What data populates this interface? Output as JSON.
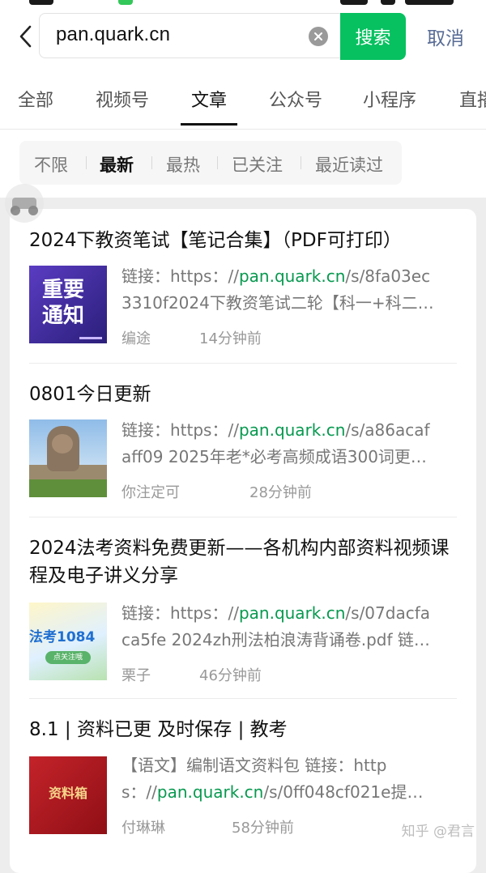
{
  "search": {
    "query": "pan.quark.cn",
    "search_label": "搜索",
    "cancel_label": "取消"
  },
  "tabs": [
    {
      "label": "全部",
      "active": false
    },
    {
      "label": "视频号",
      "active": false
    },
    {
      "label": "文章",
      "active": true
    },
    {
      "label": "公众号",
      "active": false
    },
    {
      "label": "小程序",
      "active": false
    },
    {
      "label": "直播",
      "active": false
    }
  ],
  "filters": [
    {
      "label": "不限",
      "active": false
    },
    {
      "label": "最新",
      "active": true
    },
    {
      "label": "最热",
      "active": false
    },
    {
      "label": "已关注",
      "active": false
    },
    {
      "label": "最近读过",
      "active": false
    }
  ],
  "results": [
    {
      "title": "2024下教资笔试【笔记合集】（PDF可打印）",
      "thumb_text": "重要\n通知",
      "snippet_prefix": "链接：https：//",
      "snippet_link": "pan.quark.cn",
      "snippet_suffix": "/s/8fa03ec",
      "snippet_line2": "3310f2024下教资笔试二轮【科一+科二…",
      "author": "编途",
      "time": "14分钟前"
    },
    {
      "title": "0801今日更新",
      "snippet_prefix": "链接：https：//",
      "snippet_link": "pan.quark.cn",
      "snippet_suffix": "/s/a86acaf",
      "snippet_line2": "aff09 2025年老*必考高频成语300词更…",
      "author": "你注定可",
      "time": "28分钟前"
    },
    {
      "title": "2024法考资料免费更新——各机构内部资料视频课程及电子讲义分享",
      "thumb_text": "法考1084",
      "thumb_sub": "点关注哦",
      "snippet_prefix": "链接：https：//",
      "snippet_link": "pan.quark.cn",
      "snippet_suffix": "/s/07dacfa",
      "snippet_line2": "ca5fe 2024zh刑法柏浪涛背诵卷.pdf 链…",
      "author": "栗子",
      "time": "46分钟前"
    },
    {
      "title": "8.1 | 资料已更 及时保存 | 教考",
      "thumb_text": "资料箱",
      "snippet_line1": "【语文】编制语文资料包 链接：http",
      "snippet_prefix": "s：//",
      "snippet_link": "pan.quark.cn",
      "snippet_suffix": "/s/0ff048cf021e提…",
      "author": "付琳琳",
      "time": "58分钟前"
    }
  ],
  "footer": {
    "watermark": "知乎 @君言"
  },
  "colors": {
    "accent_green": "#07c160",
    "link_green": "#07994f",
    "cancel_blue": "#576b95"
  }
}
